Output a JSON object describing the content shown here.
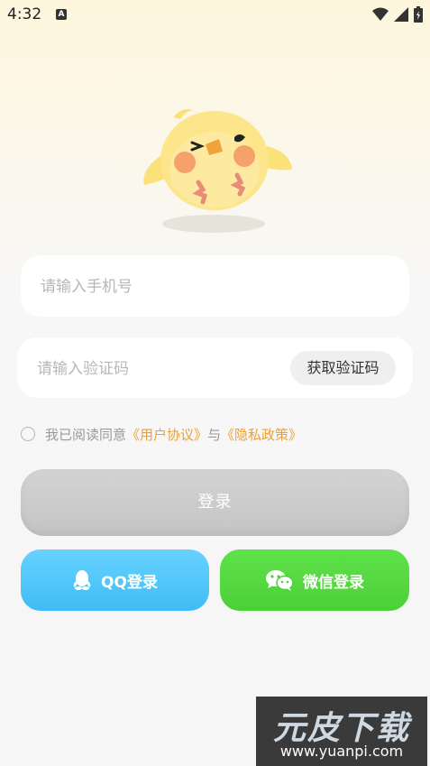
{
  "status_bar": {
    "time": "4:32",
    "notification_badge": "A"
  },
  "login": {
    "phone_placeholder": "请输入手机号",
    "code_placeholder": "请输入验证码",
    "get_code_label": "获取验证码",
    "agreement": {
      "prefix": "我已阅读同意",
      "user_agreement": "《用户协议》",
      "connector": "与",
      "privacy_policy": "《隐私政策》",
      "checked": false
    },
    "login_button": "登录",
    "qq_button": "QQ登录",
    "wechat_button": "微信登录"
  },
  "watermark": {
    "title": "元皮下载",
    "url": "www.yuanpi.com"
  },
  "colors": {
    "link": "#f0a033",
    "qq": "#4cc5f8",
    "wechat": "#55d840",
    "login_disabled": "#cbcbcb"
  }
}
